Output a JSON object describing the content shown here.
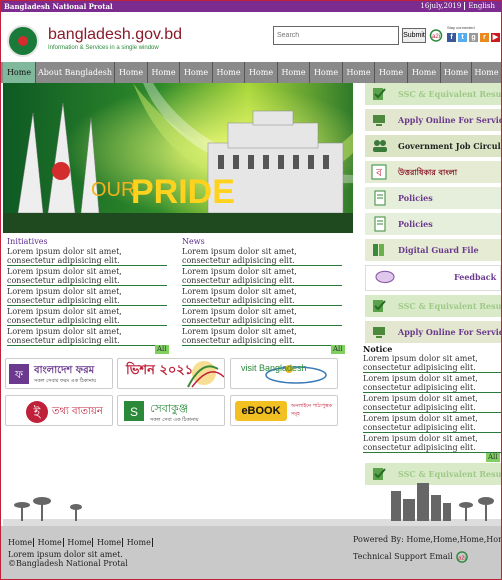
{
  "topbar": {
    "site_name": "Bangladesh National Protal",
    "date": "16july,2019",
    "language": "English"
  },
  "header": {
    "logo_title": "bangladesh.gov.bd",
    "logo_subtitle": "Information & Services in a single window",
    "search_placeholder": "Search",
    "submit_label": "Submit",
    "stay_connected": "Stay connected",
    "social_icons": [
      "facebook-icon",
      "twitter-icon",
      "google-plus-icon",
      "rss-icon",
      "youtube-icon"
    ]
  },
  "nav": {
    "items": [
      "Home",
      "About Bangladesh",
      "Home",
      "Home",
      "Home",
      "Home",
      "Home",
      "Home",
      "Home",
      "Home",
      "Home",
      "Home",
      "Home",
      "Home"
    ]
  },
  "banner": {
    "text_our": "OUR",
    "text_pride": "PRIDE"
  },
  "sidebar": {
    "items": [
      {
        "label": "SSC & Equivalent Results",
        "color": "#9ec986",
        "bg": "#d9eac9",
        "icon": "check-icon"
      },
      {
        "label": "Apply Online For Service",
        "color": "#6b3a8e",
        "bg": "#e3e7cf",
        "icon": "computer-icon"
      },
      {
        "label": "Government Job Circular",
        "color": "#222222",
        "bg": "#dbe5c6",
        "icon": "people-icon"
      },
      {
        "label": "উত্তরাধিকার বাংলা",
        "color": "#8b1a2a",
        "bg": "#e6ecd4",
        "icon": "bengali-letter-icon"
      },
      {
        "label": "Policies",
        "color": "#6b3a8e",
        "bg": "#e6eedc",
        "icon": "document-icon"
      },
      {
        "label": "Policies",
        "color": "#6b3a8e",
        "bg": "#e6eedc",
        "icon": "document-icon"
      },
      {
        "label": "Digital Guard File",
        "color": "#6b3a8e",
        "bg": "#e6ecd4",
        "icon": "folder-icon"
      },
      {
        "label": "Feedback",
        "color": "#6b3a8e",
        "bg": "#ffffff",
        "icon": "speech-bubble-icon"
      },
      {
        "label": "SSC & Equivalent Results",
        "color": "#9ec986",
        "bg": "#d9eac9",
        "icon": "check-icon"
      },
      {
        "label": "Apply Online For Service",
        "color": "#6b3a8e",
        "bg": "#e3e7cf",
        "icon": "computer-icon"
      }
    ],
    "bottom_item": {
      "label": "SSC & Equivalent Results",
      "color": "#9ec986",
      "bg": "#d9eac9",
      "icon": "check-icon"
    }
  },
  "initiatives": {
    "title": "Initiatives",
    "items": [
      "Lorem ipsum dolor sit amet, consectetur adipisicing elit.",
      "Lorem ipsum dolor sit amet, consectetur adipisicing elit.",
      "Lorem ipsum dolor sit amet, consectetur adipisicing elit.",
      "Lorem ipsum dolor sit amet, consectetur adipisicing elit.",
      "Lorem ipsum dolor sit amet, consectetur adipisicing elit."
    ],
    "all_label": "All"
  },
  "news": {
    "title": "News",
    "items": [
      "Lorem ipsum dolor sit amet, consectetur adipisicing elit.",
      "Lorem ipsum dolor sit amet, consectetur adipisicing elit.",
      "Lorem ipsum dolor sit amet, consectetur adipisicing elit.",
      "Lorem ipsum dolor sit amet, consectetur adipisicing elit.",
      "Lorem ipsum dolor sit amet, consectetur adipisicing elit."
    ],
    "all_label": "All"
  },
  "tiles": [
    {
      "label": "বাংলাদেশ ফরম",
      "sub": "সকল সেবার ফরম এক ঠিকানায়",
      "color": "#6b3a8e"
    },
    {
      "label": "ভিশন ২০২১",
      "sub": "",
      "color": "#c0203a"
    },
    {
      "label": "visit Bangladesh",
      "sub": "",
      "color": "#3a7ab8"
    },
    {
      "label": "তথ্য বাতায়ন",
      "sub": "",
      "color": "#c0203a"
    },
    {
      "label": "সেবাকুঞ্জ",
      "sub": "সকল সেবা এক ঠিকানায়",
      "color": "#2a8a3a"
    },
    {
      "label": "eBOOK",
      "sub": "অনলাইনে পাঠ্যপুস্তক সমূহ",
      "color": "#d05a1a"
    }
  ],
  "notice": {
    "title": "Notice",
    "items": [
      "Lorem ipsum dolor sit amet, consectetur adipisicing elit.",
      "Lorem ipsum dolor sit amet, consectetur adipisicing elit.",
      "Lorem ipsum dolor sit amet, consectetur adipisicing elit.",
      "Lorem ipsum dolor sit amet, consectetur adipisicing elit.",
      "Lorem ipsum dolor sit amet, consectetur adipisicing elit."
    ],
    "all_label": "All"
  },
  "footer": {
    "links": [
      "Home",
      "Home",
      "Home",
      "Home",
      "Home"
    ],
    "description": "Lorem ipsum dolor sit amet.",
    "copyright": "©Bangladesh National Protal",
    "powered_by": "Powered By: Home,Home,Home,Home",
    "technical_support": "Technical Support  Email"
  },
  "colors": {
    "topbar": "#7b2c8e",
    "accent_green": "#2a7a3a",
    "nav_bg": "#8a8a8a",
    "nav_active": "#7fb89a",
    "footer_bg": "#c9c9c9"
  }
}
